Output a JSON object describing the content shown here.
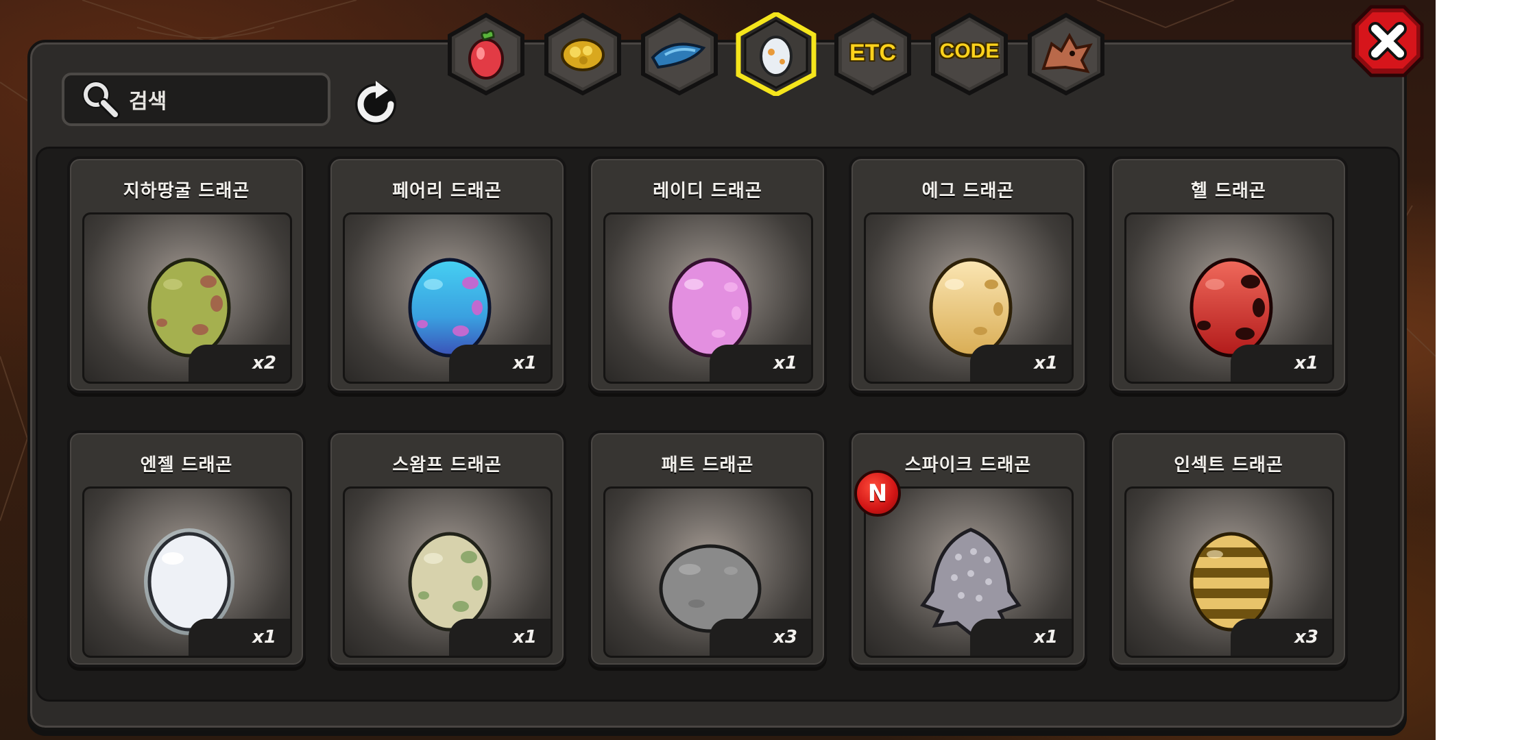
{
  "search": {
    "placeholder": "검색"
  },
  "tabs": [
    {
      "name": "fruit",
      "icon": "fruit-icon"
    },
    {
      "name": "gold",
      "icon": "gold-ore-icon"
    },
    {
      "name": "scale",
      "icon": "dragon-scale-icon"
    },
    {
      "name": "egg",
      "icon": "egg-icon",
      "selected": true
    },
    {
      "name": "etc",
      "label": "ETC"
    },
    {
      "name": "code",
      "label": "CODE"
    },
    {
      "name": "dragon",
      "icon": "dragon-head-icon"
    }
  ],
  "cards": [
    {
      "title": "지하땅굴 드래곤",
      "count": "x2",
      "egg": "green-spotted"
    },
    {
      "title": "페어리 드래곤",
      "count": "x1",
      "egg": "blue-spotted"
    },
    {
      "title": "레이디 드래곤",
      "count": "x1",
      "egg": "pink"
    },
    {
      "title": "에그 드래곤",
      "count": "x1",
      "egg": "cream"
    },
    {
      "title": "헬 드래곤",
      "count": "x1",
      "egg": "red-dark"
    },
    {
      "title": "엔젤 드래곤",
      "count": "x1",
      "egg": "white-glow"
    },
    {
      "title": "스왐프 드래곤",
      "count": "x1",
      "egg": "sage"
    },
    {
      "title": "패트 드래곤",
      "count": "x3",
      "egg": "grey-round"
    },
    {
      "title": "스파이크 드래곤",
      "count": "x1",
      "egg": "spiked",
      "new": "N"
    },
    {
      "title": "인섹트 드래곤",
      "count": "x3",
      "egg": "striped"
    }
  ],
  "colors": {
    "tab_selected_border": "#f5e51c",
    "label_gold": "#ffd21c",
    "close_red": "#d6151b"
  }
}
